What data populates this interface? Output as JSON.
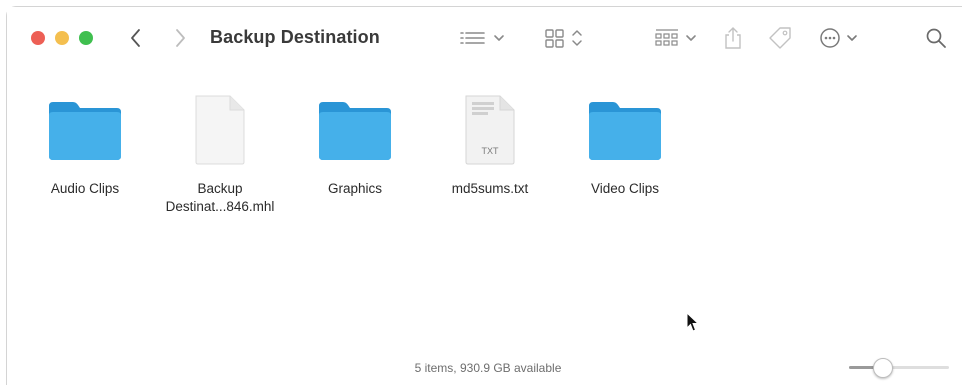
{
  "window": {
    "title": "Backup Destination",
    "colors": {
      "close": "#ed5f55",
      "minimize": "#f4bf4f",
      "maximize": "#3fbf4f",
      "folder": "#36a8e6"
    }
  },
  "toolbar": {
    "back_icon": "chevron-left-icon",
    "forward_icon": "chevron-right-icon",
    "view_icon": "list-view-icon",
    "sort_icon": "icon-grid-view-icon",
    "group_icon": "group-icon",
    "share_icon": "share-icon",
    "tag_icon": "tag-icon",
    "more_icon": "ellipsis-circle-icon",
    "search_icon": "search-icon"
  },
  "items": [
    {
      "name": "Audio Clips",
      "kind": "folder"
    },
    {
      "name": "Backup Destinat...846.mhl",
      "line1": "Backup",
      "line2": "Destinat...846.mhl",
      "kind": "document"
    },
    {
      "name": "Graphics",
      "kind": "folder"
    },
    {
      "name": "md5sums.txt",
      "kind": "text",
      "badge": "TXT"
    },
    {
      "name": "Video Clips",
      "kind": "folder"
    }
  ],
  "status": {
    "text": "5 items, 930.9 GB available",
    "zoom_level": 0.3
  }
}
